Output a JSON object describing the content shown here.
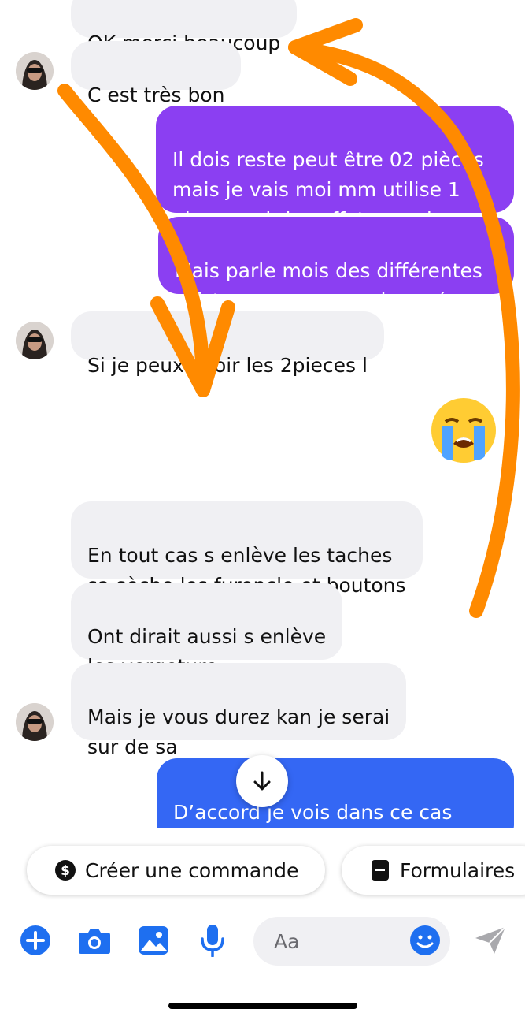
{
  "messages": [
    {
      "id": "m1",
      "text": "OK merci beaucoup"
    },
    {
      "id": "m2",
      "text": "C est très bon"
    },
    {
      "id": "m3",
      "text": "Il dois reste peut être 02 pièces\nmais je vais moi mm utilise 1\npieces voir les effets aussi"
    },
    {
      "id": "m4",
      "text": "Mais parle mois des différentes\neffet sur vous avez observé"
    },
    {
      "id": "m5",
      "text": "Si je peux avoir les 2pieces l"
    },
    {
      "id": "m6",
      "text": "En tout cas s enlève les taches\nsa sèche les furoncle et boutons"
    },
    {
      "id": "m7",
      "text": "Ont dirait aussi s enlève\nles vergeture"
    },
    {
      "id": "m8",
      "text": "Mais je vous durez kan je serai\nsur de sa"
    },
    {
      "id": "m9",
      "text": "D’accord je vois dans ce cas\npour les prochaines commande"
    }
  ],
  "reaction_emoji": "😭",
  "quick_replies": [
    {
      "label": "Créer une commande",
      "icon": "dollar-icon"
    },
    {
      "label": "Formulaires",
      "icon": "form-icon"
    }
  ],
  "composer": {
    "placeholder": "Aa"
  },
  "colors": {
    "incoming_bubble": "#f0f0f3",
    "outgoing_purple": "#8b3ff2",
    "outgoing_blue": "#3467f4",
    "toolbar_icon": "#1e6ff0",
    "annotation_arrow": "#ff8a00"
  }
}
